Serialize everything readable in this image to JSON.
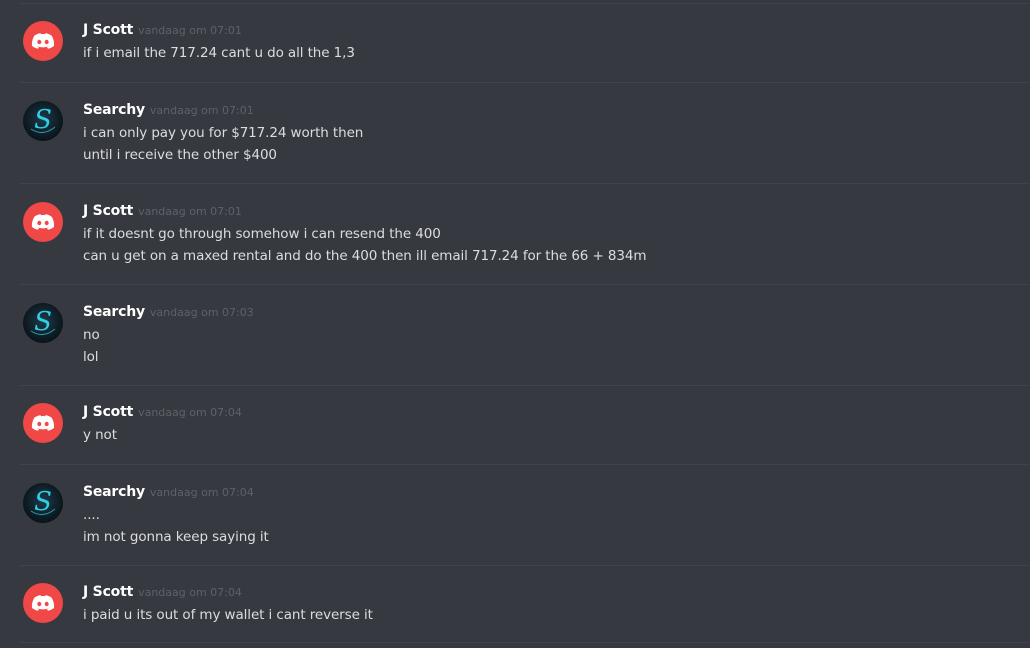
{
  "messages": [
    {
      "author": "J Scott",
      "avatar": "discord-logo-icon",
      "timestamp": "vandaag om 07:01",
      "lines": [
        "if i email the 717.24 cant u do all the 1,3"
      ]
    },
    {
      "author": "Searchy",
      "avatar": "searchy-s-logo-icon",
      "timestamp": "vandaag om 07:01",
      "lines": [
        "i can only pay you for $717.24 worth then",
        "until i receive the other $400"
      ]
    },
    {
      "author": "J Scott",
      "avatar": "discord-logo-icon",
      "timestamp": "vandaag om 07:01",
      "lines": [
        "if it doesnt go through somehow i can resend the 400",
        "can u get on a maxed rental and do the 400 then ill email 717.24 for the 66 + 834m"
      ]
    },
    {
      "author": "Searchy",
      "avatar": "searchy-s-logo-icon",
      "timestamp": "vandaag om 07:03",
      "lines": [
        "no",
        "lol"
      ]
    },
    {
      "author": "J Scott",
      "avatar": "discord-logo-icon",
      "timestamp": "vandaag om 07:04",
      "lines": [
        "y not"
      ]
    },
    {
      "author": "Searchy",
      "avatar": "searchy-s-logo-icon",
      "timestamp": "vandaag om 07:04",
      "lines": [
        "....",
        "im not gonna keep saying it"
      ]
    },
    {
      "author": "J Scott",
      "avatar": "discord-logo-icon",
      "timestamp": "vandaag om 07:04",
      "lines": [
        "i paid u its out of my wallet i cant reverse it"
      ]
    }
  ],
  "colors": {
    "background": "#36393f",
    "username": "#ffffff",
    "message_text": "#dcddde",
    "timestamp": "#5e6167",
    "discord_avatar": "#f04747",
    "searchy_accent": "#2fd0e6"
  }
}
